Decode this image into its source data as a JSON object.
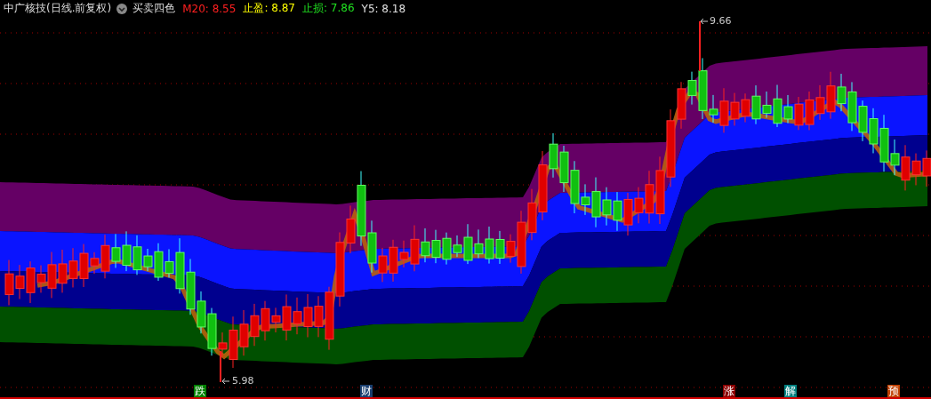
{
  "header": {
    "stock_name": "中广核技(日线.前复权)",
    "indicator_name": "买卖四色",
    "readings": [
      {
        "label": "M20:",
        "value": "8.55",
        "color": "#ff2020"
      },
      {
        "label": "止盈:",
        "value": "8.87",
        "color": "#ffff00"
      },
      {
        "label": "止损:",
        "value": "7.86",
        "color": "#20e020"
      },
      {
        "label": "Y5:",
        "value": "8.18",
        "color": "#e0e0e0"
      }
    ]
  },
  "high_marker": "9.66",
  "low_marker": "5.98",
  "signals": [
    {
      "char": "跌",
      "color": "#008000"
    },
    {
      "char": "财",
      "color": "#1a3f6f"
    },
    {
      "char": "涨",
      "color": "#8b0000"
    },
    {
      "char": "解",
      "color": "#008080"
    },
    {
      "char": "预",
      "color": "#c04000"
    }
  ]
}
